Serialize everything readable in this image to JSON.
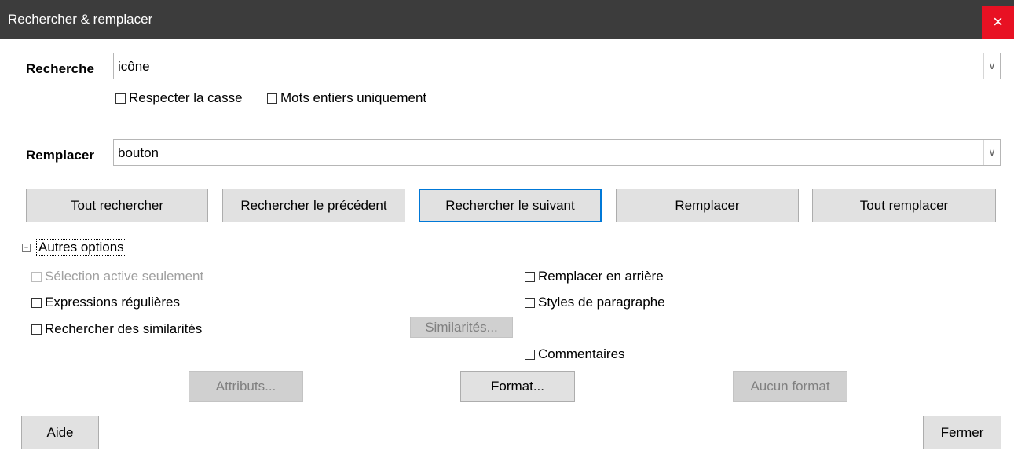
{
  "window": {
    "title": "Rechercher & remplacer",
    "close_icon": "×"
  },
  "search": {
    "label": "Recherche",
    "value": "icône",
    "options": [
      {
        "label": "Respecter la casse",
        "checked": false
      },
      {
        "label": "Mots entiers uniquement",
        "checked": false
      }
    ]
  },
  "replace": {
    "label": "Remplacer",
    "value": "bouton"
  },
  "dropdown_icon": "∨",
  "actions": {
    "find_all": "Tout rechercher",
    "find_previous": "Rechercher le précédent",
    "find_next": "Rechercher le suivant",
    "replace": "Remplacer",
    "replace_all": "Tout remplacer"
  },
  "more_options": {
    "label": "Autres options",
    "toggle_icon": "−",
    "expanded": true,
    "left": [
      {
        "label": "Sélection active seulement",
        "checked": false,
        "enabled": false
      },
      {
        "label": "Expressions régulières",
        "checked": false,
        "enabled": true
      },
      {
        "label": "Rechercher des similarités",
        "checked": false,
        "enabled": true
      }
    ],
    "similarities_button": "Similarités...",
    "right": [
      {
        "label": "Remplacer en arrière",
        "checked": false
      },
      {
        "label": "Styles de paragraphe",
        "checked": false
      },
      {
        "label": "Commentaires",
        "checked": false
      }
    ],
    "attributes_button": "Attributs...",
    "format_button": "Format...",
    "no_format_button": "Aucun format"
  },
  "footer": {
    "help": "Aide",
    "close": "Fermer"
  }
}
